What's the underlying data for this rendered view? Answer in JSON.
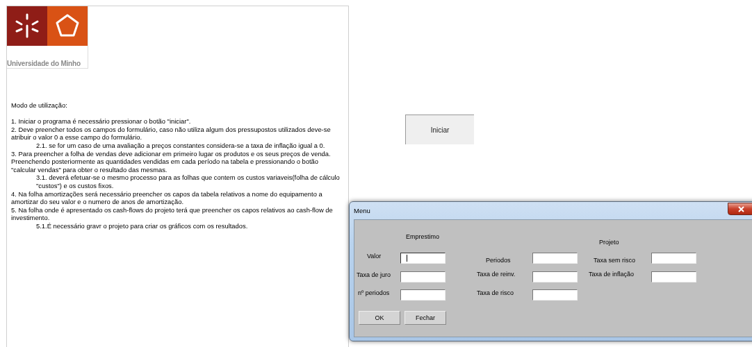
{
  "logo": {
    "text": "Universidade do Minho"
  },
  "instructions": {
    "heading": "Modo de utilização:",
    "items": [
      {
        "kind": "item",
        "text": "1. Iniciar o programa é necessário pressionar o botão \"iniciar\"."
      },
      {
        "kind": "item",
        "text": "2. Deve preencher todos os campos do formulário, caso não utiliza algum dos pressupostos utilizados deve-se atribuir o valor 0 a esse campo do formulário."
      },
      {
        "kind": "subitem",
        "text": "2.1. se for um caso de uma avaliação a preços constantes considera-se a taxa de inflação igual a 0."
      },
      {
        "kind": "item",
        "text": "3. Para preencher a folha de vendas deve adicionar em primeiro lugar os produtos e os seus preços de venda. Preenchendo posteriormente as quantidades vendidas em cada período na tabela e pressionando o botão \"calcular vendas\" para obter o resultado das mesmas."
      },
      {
        "kind": "subitem",
        "text": "3.1.  deverá efetuar-se o mesmo processo para as folhas que contem os custos variaveis(folha de cálculo \"custos\") e os custos fixos."
      },
      {
        "kind": "item",
        "text": "4. Na folha amortizações será necessário preencher os capos da tabela relativos a nome do equipamento a amortizar do seu valor e o numero de anos de amortização."
      },
      {
        "kind": "item",
        "text": "5. Na folha onde é apresentado os cash-flows do projeto terá que preencher os capos relativos ao cash-flow de investimento."
      },
      {
        "kind": "subitem",
        "text": "5.1.É necessário gravr o projeto para criar os gráficos com os resultados."
      }
    ]
  },
  "start_button": {
    "label": "Iniciar"
  },
  "dialog": {
    "title": "Menu",
    "emprestimo": {
      "heading": "Emprestimo",
      "fields": [
        {
          "label": "Valor",
          "focused": true
        },
        {
          "label": "Taxa de juro",
          "focused": false
        },
        {
          "label": "nº periodos",
          "focused": false
        }
      ]
    },
    "projeto": {
      "heading": "Projeto",
      "fields": [
        {
          "label": "Periodos",
          "focused": false
        },
        {
          "label": "Taxa de reinv.",
          "focused": false
        },
        {
          "label": "Taxa de risco",
          "focused": false
        },
        {
          "label": "Taxa sem risco",
          "focused": false
        },
        {
          "label": "Taxa de inflação",
          "focused": false
        }
      ]
    },
    "buttons": [
      "OK",
      "Fechar"
    ]
  }
}
